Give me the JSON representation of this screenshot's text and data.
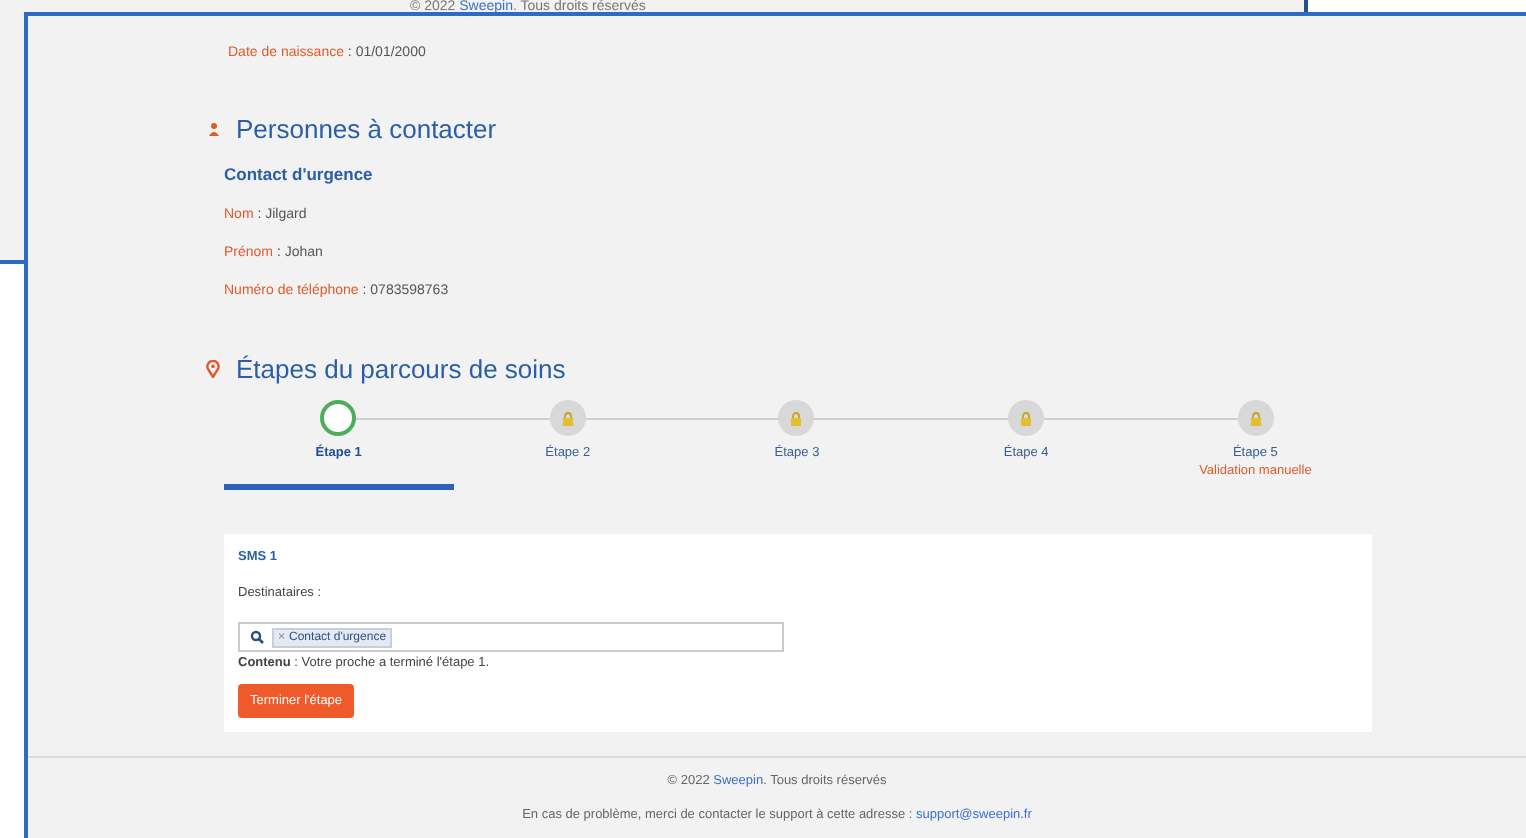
{
  "background_window": {
    "copyright": "© 2022",
    "brand": "Sweepin",
    "rights": ". Tous droits réservés"
  },
  "profile": {
    "fields": [
      {
        "label": "Date de naissance",
        "value": " : 01/01/2000"
      }
    ]
  },
  "contacts": {
    "title": "Personnes à contacter",
    "subtitle": "Contact d'urgence",
    "fields": [
      {
        "label": "Nom",
        "value": " : Jilgard"
      },
      {
        "label": "Prénom",
        "value": " : Johan"
      },
      {
        "label": "Numéro de téléphone",
        "value": " : 0783598763"
      }
    ]
  },
  "care_path": {
    "title": "Étapes du parcours de soins",
    "steps": [
      {
        "label": "Étape 1",
        "selected": true,
        "locked": false
      },
      {
        "label": "Étape 2",
        "selected": false,
        "locked": true
      },
      {
        "label": "Étape 3",
        "selected": false,
        "locked": true
      },
      {
        "label": "Étape 4",
        "selected": false,
        "locked": true
      },
      {
        "label": "Étape 5",
        "selected": false,
        "locked": true,
        "note": "Validation manuelle"
      }
    ]
  },
  "sms_card": {
    "title": "SMS 1",
    "recipients_label": "Destinataires :",
    "recipients": [
      {
        "label": "Contact d'urgence",
        "remove": "×"
      }
    ],
    "content_label": "Contenu",
    "content": " : Votre proche a terminé l'étape 1.",
    "button": "Terminer l'étape"
  },
  "footer": {
    "copyright": "© 2022",
    "brand": "Sweepin",
    "rights": ". Tous droits réservés",
    "help": "En cas de problème, merci de contacter le support à cette adresse :",
    "email": "support@sweepin.fr"
  }
}
